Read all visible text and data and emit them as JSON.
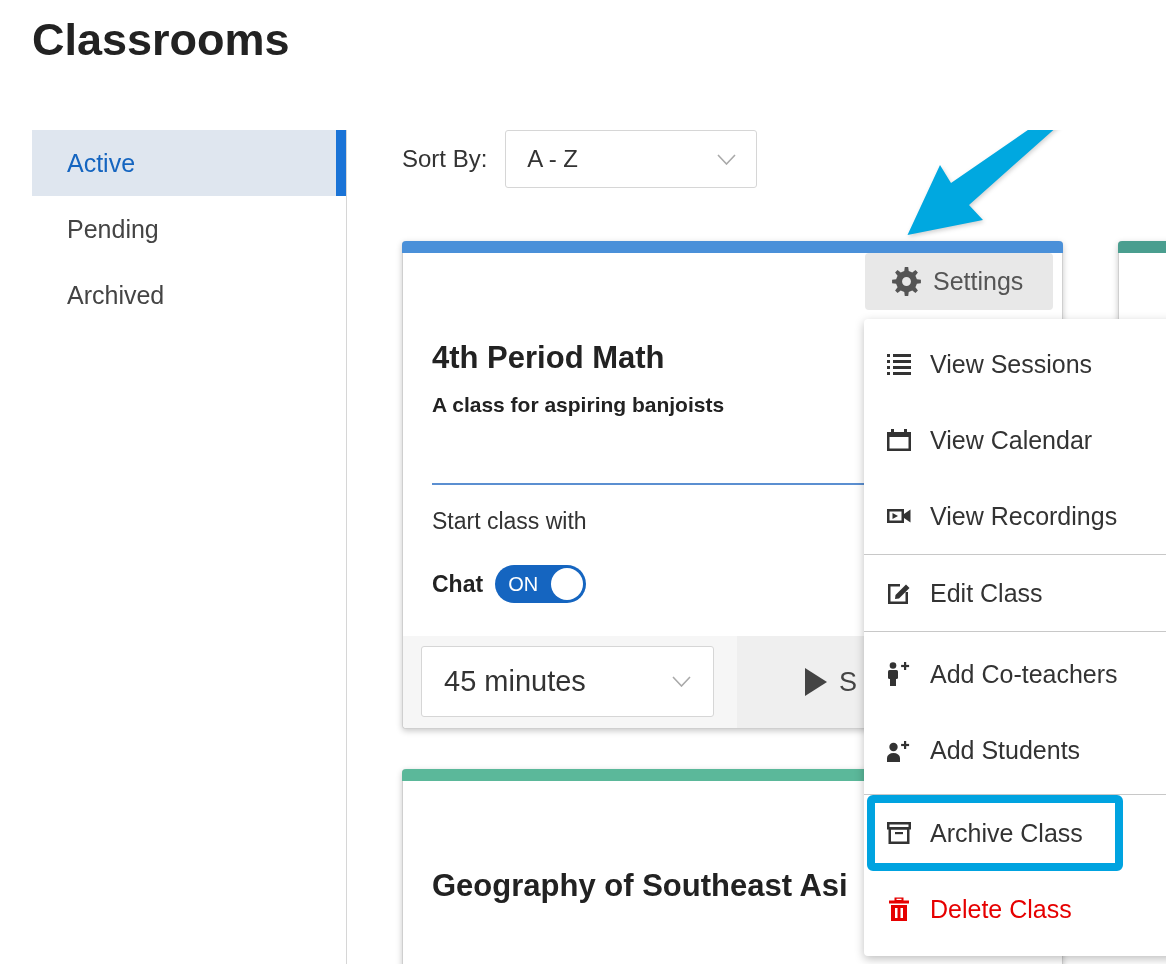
{
  "page": {
    "title": "Classrooms"
  },
  "sidebar": {
    "items": [
      {
        "label": "Active",
        "selected": true
      },
      {
        "label": "Pending",
        "selected": false
      },
      {
        "label": "Archived",
        "selected": false
      }
    ]
  },
  "sort": {
    "label": "Sort By:",
    "value": "A - Z"
  },
  "classes": [
    {
      "color": "#4a90d9",
      "settings": {
        "label": "Settings",
        "pointed_at": true,
        "expanded": true,
        "menu": {
          "sections": [
            {
              "items": [
                {
                  "label": "View Sessions",
                  "kind": "normal",
                  "highlighted": false
                },
                {
                  "label": "View Calendar",
                  "kind": "normal",
                  "highlighted": false
                },
                {
                  "label": "View Recordings",
                  "kind": "normal",
                  "highlighted": false
                }
              ]
            },
            {
              "items": [
                {
                  "label": "Edit Class",
                  "kind": "normal",
                  "highlighted": false
                }
              ]
            },
            {
              "items": [
                {
                  "label": "Add Co-teachers",
                  "kind": "normal",
                  "highlighted": false
                },
                {
                  "label": "Add Students",
                  "kind": "normal",
                  "highlighted": false
                }
              ]
            },
            {
              "items": [
                {
                  "label": "Archive Class",
                  "kind": "normal",
                  "highlighted": true
                },
                {
                  "label": "Delete Class",
                  "kind": "danger",
                  "highlighted": false
                }
              ]
            }
          ]
        }
      },
      "title": "4th Period Math",
      "description": "A class for aspiring banjoists",
      "start_with": {
        "label": "Start class with",
        "options": [
          {
            "label": "Chat",
            "on": true,
            "state_label": "ON"
          }
        ]
      },
      "duration": {
        "value": "45 minutes"
      },
      "start_button": {
        "label": "S"
      }
    },
    {
      "color": "#4a9e8f"
    },
    {
      "color": "#5bb89a",
      "title": "Geography of Southeast Asi"
    }
  ]
}
